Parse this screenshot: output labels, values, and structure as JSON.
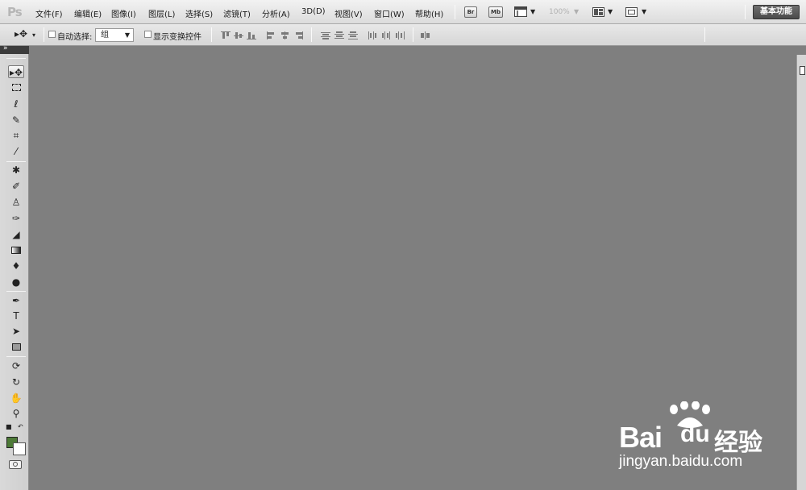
{
  "app": {
    "logo": "Ps"
  },
  "menubar": {
    "items": [
      "文件(F)",
      "编辑(E)",
      "图像(I)",
      "图层(L)",
      "选择(S)",
      "滤镜(T)",
      "分析(A)",
      "3D(D)",
      "视图(V)",
      "窗口(W)",
      "帮助(H)"
    ],
    "bridge_label": "Br",
    "minibridge_label": "Mb",
    "zoom": "100%",
    "workspace": "基本功能"
  },
  "options": {
    "auto_select_label": "自动选择:",
    "auto_select_value": "组",
    "show_transform_label": "显示变换控件",
    "auto_select_checked": false,
    "show_transform_checked": false
  },
  "tools": {
    "foreground_color": "#4d7a37",
    "background_color": "#ffffff",
    "type_glyph": "T"
  },
  "watermark": {
    "brand_bai": "Bai",
    "brand_du": "du",
    "brand_jingyan": "经验",
    "url": "jingyan.baidu.com"
  },
  "colors": {
    "canvas_bg": "#7f7f7f",
    "toolbar_bg": "#d9d9d9",
    "menubar_bg": "#e8e8e8"
  }
}
